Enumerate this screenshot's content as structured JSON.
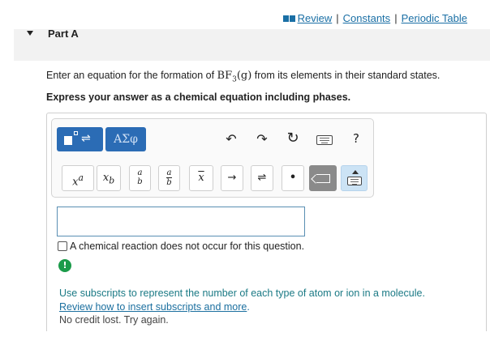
{
  "links": {
    "review": "Review",
    "constants": "Constants",
    "periodic_table": "Periodic Table",
    "separator": "|"
  },
  "part": {
    "title": "Part A"
  },
  "question": {
    "prefix": "Enter an equation for the formation of ",
    "formula_main": "BF",
    "formula_sub": "3",
    "formula_phase": "(g)",
    "suffix": " from its elements in their standard states."
  },
  "instruction": "Express your answer as a chemical equation including phases.",
  "toolbar": {
    "templates_arrow": "⇌",
    "greek_label": "ΑΣφ",
    "undo": "↶",
    "redo": "↷",
    "reset": "↻",
    "help": "?"
  },
  "keypad": {
    "superscript_base": "x",
    "superscript_exp": "a",
    "subscript_base": "x",
    "subscript_sub": "b",
    "fraction_num": "a",
    "fraction_den": "b",
    "vector": "x",
    "arrow": "→",
    "equilibrium": "⇌",
    "dot": "•",
    "delete_x": "x"
  },
  "answer": {
    "value": ""
  },
  "no_reaction": {
    "label": "A chemical reaction does not occur for this question.",
    "checked": false
  },
  "feedback": {
    "alert_icon": "!",
    "message": "Use subscripts to represent the number of each type of atom or ion in a molecule.",
    "link": "Review how to insert subscripts and more",
    "link_period": ".",
    "note": "No credit lost. Try again."
  }
}
